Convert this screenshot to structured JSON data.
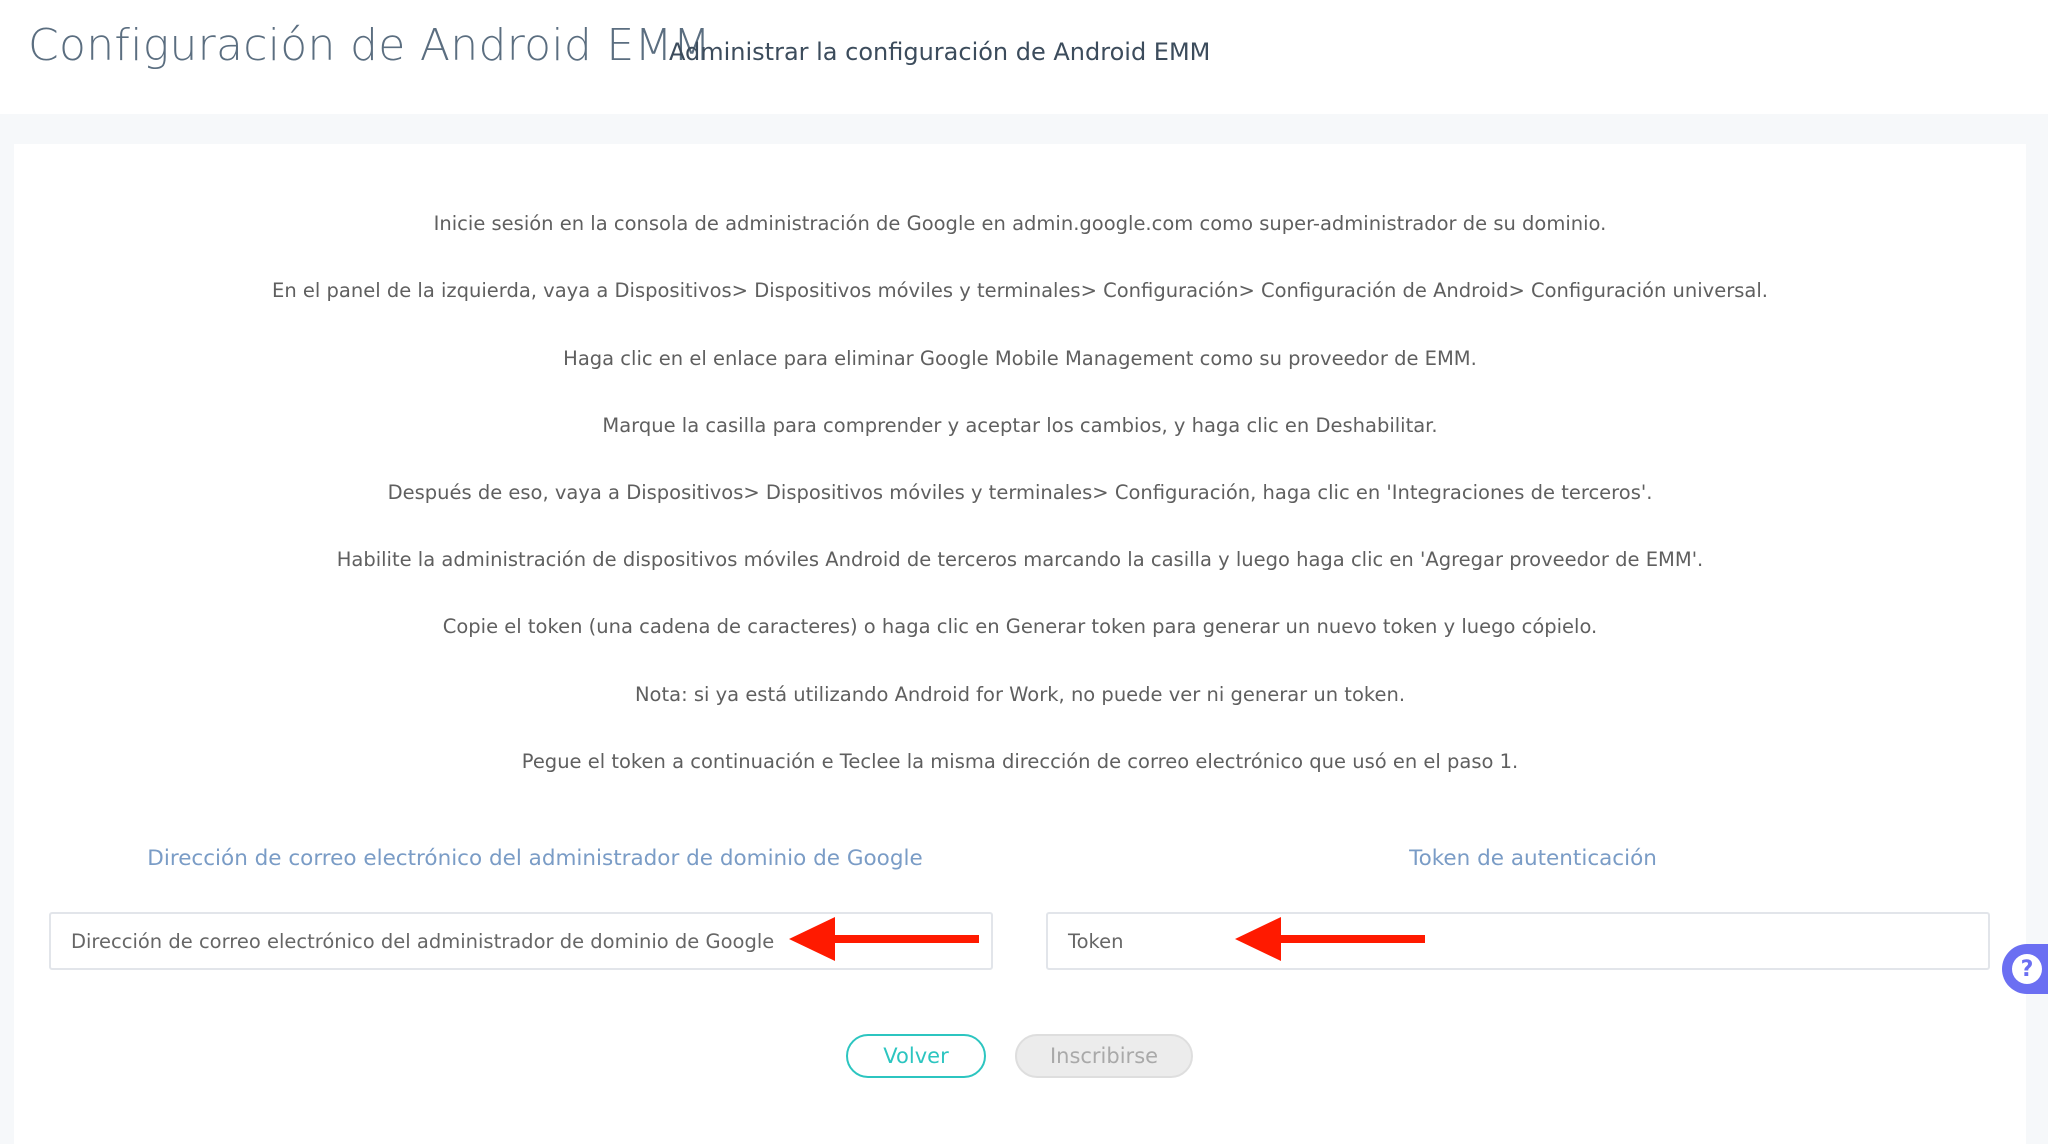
{
  "header": {
    "title": "Configuración de Android EMM",
    "subtitle": "Administrar la configuración de Android EMM"
  },
  "instructions": [
    "Inicie sesión en la consola de administración de Google en admin.google.com como super-administrador de su dominio.",
    "En el panel de la izquierda, vaya a Dispositivos> Dispositivos móviles y terminales> Configuración> Configuración de Android> Configuración universal.",
    "Haga clic en el enlace para eliminar Google Mobile Management como su proveedor de EMM.",
    "Marque la casilla para comprender y aceptar los cambios, y haga clic en Deshabilitar.",
    "Después de eso, vaya a Dispositivos> Dispositivos móviles y terminales> Configuración, haga clic en 'Integraciones de terceros'.",
    "Habilite la administración de dispositivos móviles Android de terceros marcando la casilla y luego haga clic en 'Agregar proveedor de EMM'.",
    "Copie el token (una cadena de caracteres) o haga clic en Generar token para generar un nuevo token y luego cópielo.",
    "Nota: si ya está utilizando Android for Work, no puede ver ni generar un token.",
    "Pegue el token a continuación e Teclee la misma dirección de correo electrónico que usó en el paso 1."
  ],
  "form": {
    "email_label": "Dirección de correo electrónico del administrador de dominio de Google",
    "email_placeholder": "Dirección de correo electrónico del administrador de dominio de Google",
    "token_label": "Token de autenticación",
    "token_placeholder": "Token"
  },
  "buttons": {
    "back": "Volver",
    "enroll": "Inscribirse"
  },
  "help": {
    "icon": "question-circle-icon",
    "glyph": "?"
  },
  "colors": {
    "accent_teal": "#2cc5c0",
    "label_blue": "#7a9cc6",
    "annotation_red": "#ff1a00",
    "help_purple": "#6b6ff2"
  }
}
